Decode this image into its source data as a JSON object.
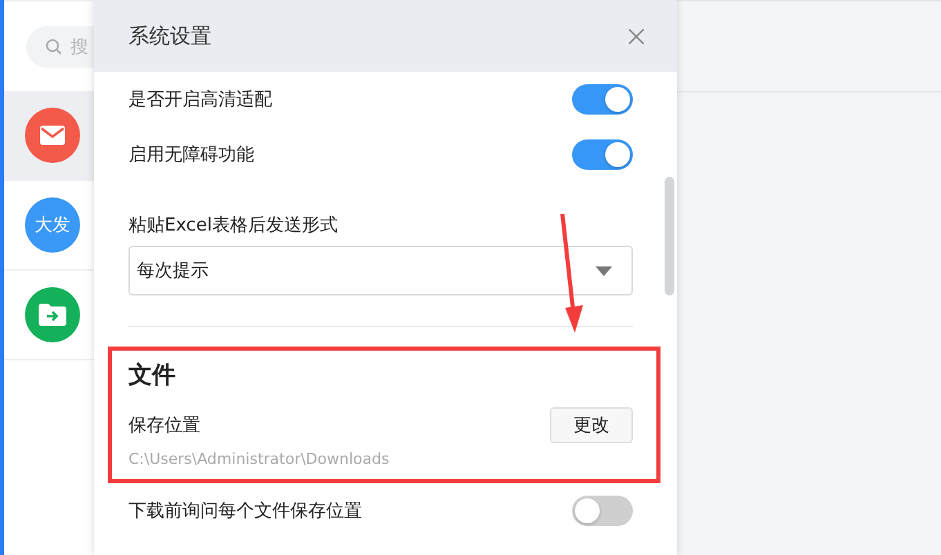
{
  "sidebar": {
    "search": {
      "placeholder": "搜"
    },
    "items": [
      {
        "kind": "mail",
        "selected": true,
        "color": "#f45a4a"
      },
      {
        "kind": "text",
        "label": "大发",
        "selected": false,
        "color": "#3a98f6"
      },
      {
        "kind": "folder",
        "selected": false,
        "color": "#14b15a"
      }
    ]
  },
  "dialog": {
    "title": "系统设置",
    "settings": [
      {
        "kind": "toggle",
        "label": "是否开启高清适配",
        "on": true
      },
      {
        "kind": "toggle",
        "label": "启用无障碍功能",
        "on": true
      },
      {
        "kind": "select",
        "label": "粘贴Excel表格后发送形式",
        "value": "每次提示"
      }
    ],
    "section": {
      "title": "文件",
      "label": "保存位置",
      "button": "更改",
      "path": "C:\\Users\\Administrator\\Downloads"
    },
    "after": [
      {
        "kind": "toggle",
        "label": "下载前询问每个文件保存位置",
        "on": false
      }
    ]
  }
}
